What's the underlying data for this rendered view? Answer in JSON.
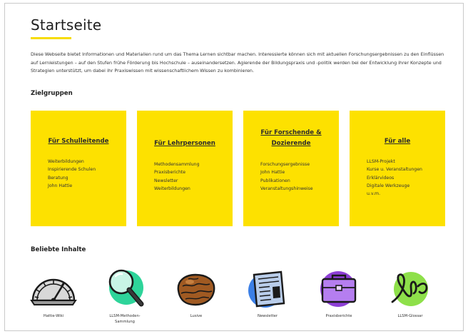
{
  "page": {
    "title": "Startseite",
    "intro": "Diese Webseite bietet Informationen und Materialien rund um das Thema Lernen sichtbar machen. Interessierte können sich mit aktuellen Forschungsergebnissen zu den Einflüssen auf Lernleistungen – auf den Stufen frühe Förderung bis Hochschule – auseinandersetzen. Agierende der Bildungspraxis und -politik werden bei der Entwicklung ihrer Konzepte und Strategien unterstützt, um dabei ihr Praxiswissen mit wissenschaftlichem Wissen zu kombinieren."
  },
  "zielgruppen": {
    "heading": "Zielgruppen",
    "tiles": [
      {
        "title": "Für Schulleitende",
        "items": [
          "Weiterbildungen",
          "Inspirierende Schulen",
          "Beratung",
          "John Hattie"
        ]
      },
      {
        "title": "Für Lehrpersonen",
        "items": [
          "Methodensammlung",
          "Praxisberichte",
          "Newsletter",
          "Weiterbildungen"
        ]
      },
      {
        "title_line1": "Für Forschende &",
        "title_line2": "Dozierende",
        "items": [
          "Forschungsergebnisse",
          "John Hattie",
          "Publikationen",
          "Veranstaltungshinweise"
        ]
      },
      {
        "title": "Für alle",
        "items": [
          "LLSM-Projekt",
          "Kurse u. Veranstaltungen",
          "Erklärvideos",
          "Digitale Werkzeuge",
          "u.v.m."
        ]
      }
    ]
  },
  "beliebte_inhalte": {
    "heading": "Beliebte Inhalte",
    "items": [
      {
        "label": "Hattie-Wiki",
        "icon": "barometer-icon"
      },
      {
        "label_line1": "LLSM-Methoden-",
        "label_line2": "Sammlung",
        "icon": "magnifier-icon"
      },
      {
        "label": "Lusive",
        "icon": "walnut-icon"
      },
      {
        "label": "Newsletter",
        "icon": "newspaper-icon"
      },
      {
        "label": "Praxisberichte",
        "icon": "briefcase-icon"
      },
      {
        "label": "LLSM-Glossar",
        "icon": "abc-icon"
      }
    ]
  },
  "colors": {
    "accent_yellow": "#fde100",
    "green": "#2ed49a",
    "blue": "#3b7fe6",
    "purple": "#8e3fd6",
    "lime": "#8ee04a"
  }
}
